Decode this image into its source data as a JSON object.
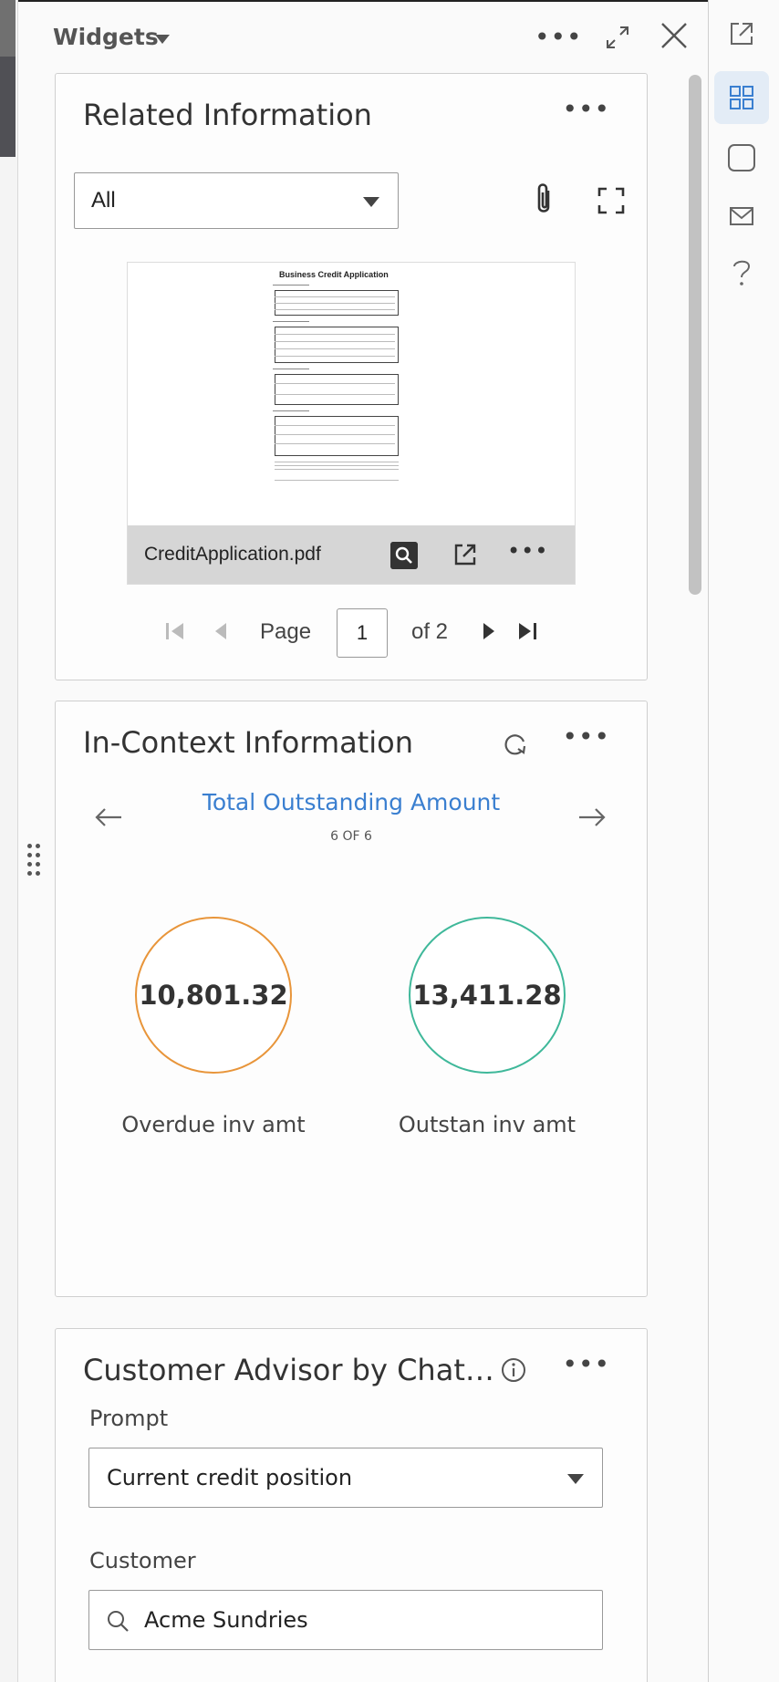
{
  "panel": {
    "title": "Widgets"
  },
  "related": {
    "title": "Related Information",
    "filter_value": "All",
    "file_name": "CreditApplication.pdf",
    "document_heading": "Business Credit Application",
    "pager": {
      "page_label": "Page",
      "current_page": "1",
      "of_label": "of 2"
    }
  },
  "in_context": {
    "title": "In-Context Information",
    "kpi_title": "Total Outstanding Amount",
    "kpi_position": "6 OF 6",
    "metrics": [
      {
        "value": "10,801.32",
        "label": "Overdue inv amt",
        "color": "#e8953a"
      },
      {
        "value": "13,411.28",
        "label": "Outstan inv amt",
        "color": "#3fb89a"
      }
    ]
  },
  "advisor": {
    "title": "Customer Advisor by Chat…",
    "prompt_label": "Prompt",
    "prompt_value": "Current credit position",
    "customer_label": "Customer",
    "customer_value": "Acme Sundries"
  },
  "rail": {
    "items": [
      "open-external-icon",
      "widgets-grid-icon",
      "square-icon",
      "mail-icon",
      "help-icon"
    ],
    "active_index": 1,
    "accent": "#3a7fd0"
  },
  "colors": {
    "accent": "#3a7fd0",
    "overdue": "#e8953a",
    "outstanding": "#3fb89a"
  }
}
